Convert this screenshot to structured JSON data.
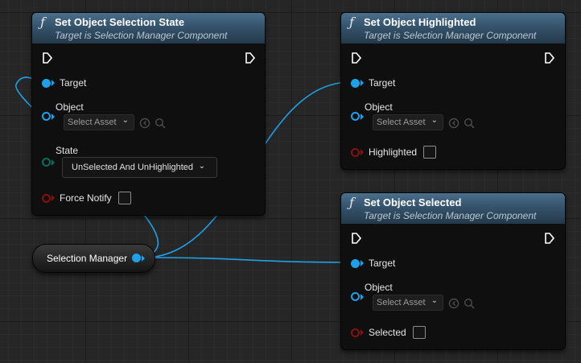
{
  "colors": {
    "wire": "#1ea1e8",
    "header_top": "#4a6f8c",
    "header_bottom": "#24394a",
    "object_pin": "#1ea1e8",
    "enum_pin": "#0d6d5d",
    "bool_pin": "#8a0f0f",
    "node_body": "#0f0f0f",
    "grid_bg": "#262626"
  },
  "nodes": {
    "selection_state": {
      "icon": "function-icon",
      "title": "Set Object Selection State",
      "subtitle": "Target is Selection Manager Component",
      "target_label": "Target",
      "object_label": "Object",
      "object_placeholder": "Select Asset",
      "state_label": "State",
      "state_value": "UnSelected And UnHighlighted",
      "force_notify_label": "Force Notify",
      "force_notify_checked": false
    },
    "highlighted": {
      "icon": "function-icon",
      "title": "Set Object Highlighted",
      "subtitle": "Target is Selection Manager Component",
      "target_label": "Target",
      "object_label": "Object",
      "object_placeholder": "Select Asset",
      "bool_label": "Highlighted",
      "bool_checked": false
    },
    "selected": {
      "icon": "function-icon",
      "title": "Set Object Selected",
      "subtitle": "Target is Selection Manager Component",
      "target_label": "Target",
      "object_label": "Object",
      "object_placeholder": "Select Asset",
      "bool_label": "Selected",
      "bool_checked": false
    }
  },
  "variable": {
    "label": "Selection Manager"
  }
}
